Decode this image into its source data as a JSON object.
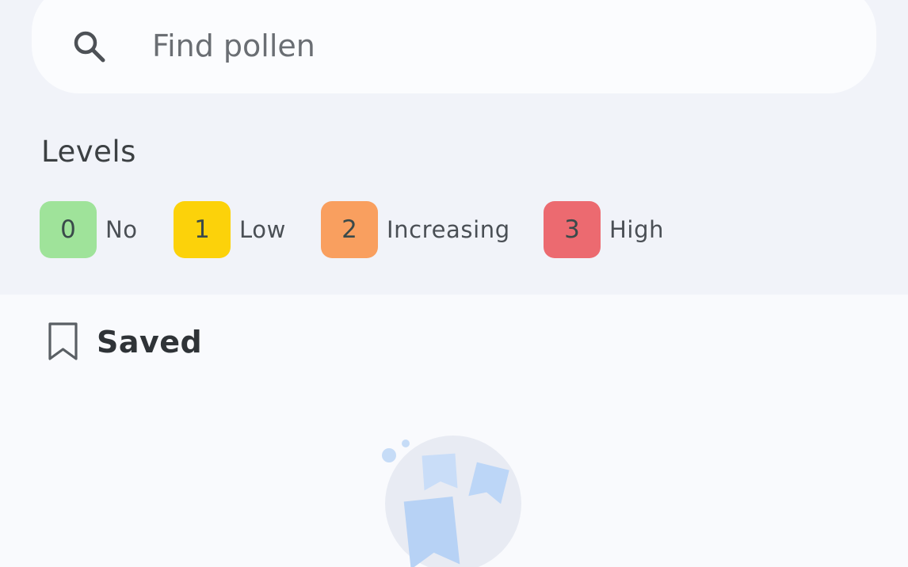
{
  "search": {
    "placeholder": "Find pollen",
    "icon": "search-icon"
  },
  "levels": {
    "title": "Levels",
    "items": [
      {
        "value": "0",
        "label": "No",
        "color": "#9fe39a"
      },
      {
        "value": "1",
        "label": "Low",
        "color": "#fcd20a"
      },
      {
        "value": "2",
        "label": "Increasing",
        "color": "#f99f5f"
      },
      {
        "value": "3",
        "label": "High",
        "color": "#ec6a70"
      }
    ]
  },
  "saved": {
    "label": "Saved",
    "icon": "bookmark-icon",
    "empty_illustration": "saved-empty-illustration"
  },
  "colors": {
    "panel_background": "#f1f3f9",
    "page_background": "#f9fafd",
    "illustration_circle": "#e8ebf3",
    "illustration_bookmark": "#bcd6f7"
  }
}
